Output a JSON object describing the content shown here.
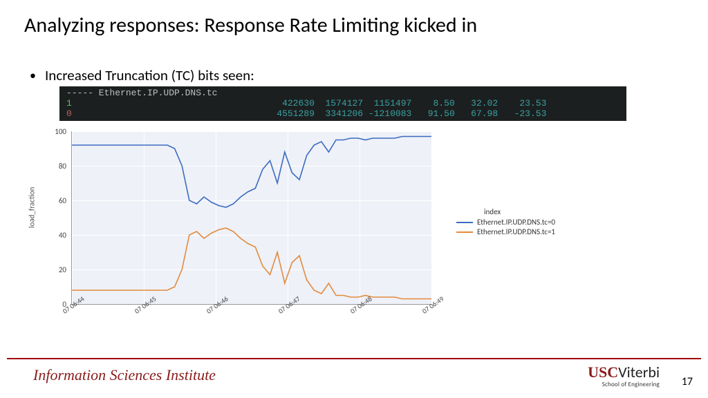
{
  "title": "Analyzing responses: Response Rate Limiting kicked in",
  "bullet": "Increased Truncation (TC) bits seen:",
  "terminal": {
    "header": "----- Ethernet.IP.UDP.DNS.tc",
    "rows": [
      {
        "label": "1",
        "c1": "422630",
        "c2": "1574127",
        "c3": "1151497",
        "c4": "8.50",
        "c5": "32.02",
        "c6": "23.53"
      },
      {
        "label": "0",
        "c1": "4551289",
        "c2": "3341206",
        "c3": "-1210083",
        "c4": "91.50",
        "c5": "67.98",
        "c6": "-23.53"
      }
    ]
  },
  "chart_data": {
    "type": "line",
    "ylabel": "load_fraction",
    "ylim": [
      0,
      100
    ],
    "yticks": [
      0,
      20,
      40,
      60,
      80,
      100
    ],
    "xticks": [
      "07 06:44",
      "07 06:45",
      "07 06:46",
      "07 06:47",
      "07 06:48",
      "07 06:49"
    ],
    "legend_title": "index",
    "series": [
      {
        "name": "Ethernet.IP.UDP.DNS.tc=0",
        "color": "#3b6bbf",
        "values": [
          92,
          92,
          92,
          92,
          92,
          92,
          92,
          92,
          92,
          92,
          92,
          92,
          92,
          92,
          90,
          80,
          60,
          58,
          62,
          59,
          57,
          56,
          58,
          62,
          65,
          67,
          78,
          83,
          70,
          88,
          76,
          72,
          86,
          92,
          94,
          88,
          95,
          95,
          96,
          96,
          95,
          96,
          96,
          96,
          96,
          97,
          97,
          97,
          97,
          97
        ]
      },
      {
        "name": "Ethernet.IP.UDP.DNS.tc=1",
        "color": "#e38a3c",
        "values": [
          8,
          8,
          8,
          8,
          8,
          8,
          8,
          8,
          8,
          8,
          8,
          8,
          8,
          8,
          10,
          20,
          40,
          42,
          38,
          41,
          43,
          44,
          42,
          38,
          35,
          33,
          22,
          17,
          30,
          12,
          24,
          28,
          14,
          8,
          6,
          12,
          5,
          5,
          4,
          4,
          5,
          4,
          4,
          4,
          4,
          3,
          3,
          3,
          3,
          3
        ]
      }
    ]
  },
  "legend": {
    "title": "index",
    "items": [
      {
        "color": "#3b6bbf",
        "label": "Ethernet.IP.UDP.DNS.tc=0"
      },
      {
        "color": "#e38a3c",
        "label": "Ethernet.IP.UDP.DNS.tc=1"
      }
    ]
  },
  "footer": {
    "left": "Information Sciences Institute",
    "usc": "USC",
    "viterbi": "Viterbi",
    "soe": "School of Engineering",
    "page": "17"
  }
}
